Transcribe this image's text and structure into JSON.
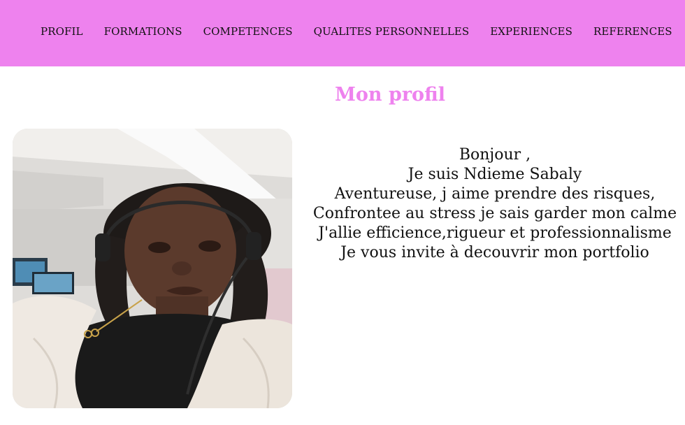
{
  "nav": {
    "items": [
      {
        "label": "PROFIL"
      },
      {
        "label": "FORMATIONS"
      },
      {
        "label": "COMPETENCES"
      },
      {
        "label": "QUALITES PERSONNELLES"
      },
      {
        "label": "EXPERIENCES"
      },
      {
        "label": "REFERENCES"
      }
    ]
  },
  "main": {
    "title": "Mon profil",
    "intro_lines": [
      "Bonjour ,",
      "Je suis Ndieme Sabaly",
      "Aventureuse, j aime prendre des risques,",
      "Confrontee au stress je sais garder mon calme",
      "J'allie efficience,rigueur et professionnalisme",
      "Je vous invite à decouvrir mon portfolio"
    ]
  },
  "colors": {
    "nav_background": "#ee82ee",
    "title": "#ee82ee",
    "text": "#111111"
  }
}
